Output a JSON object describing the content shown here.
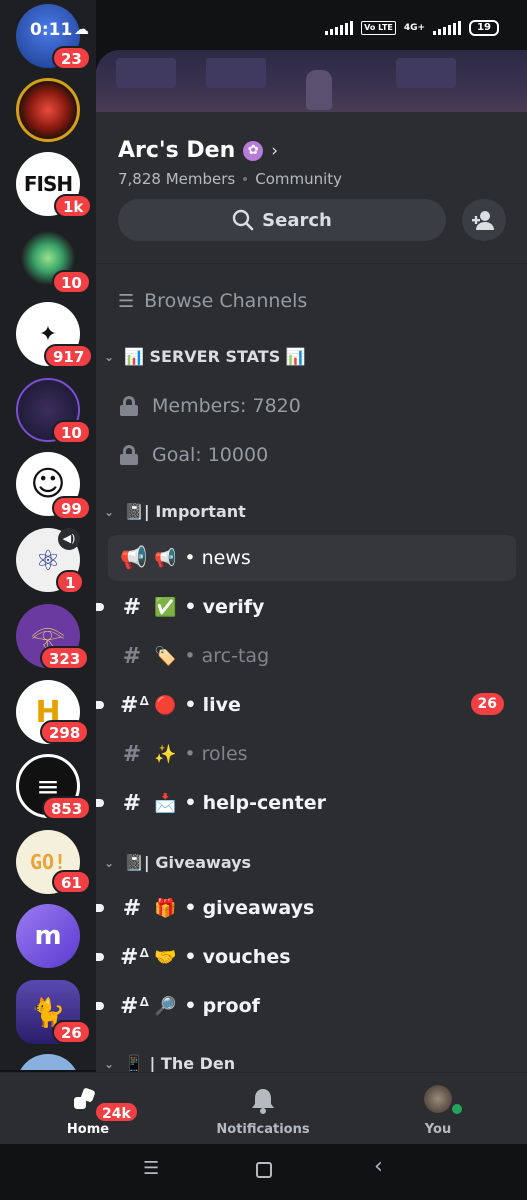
{
  "status": {
    "time": "0:11",
    "network": "4G+",
    "volte": "Vo LTE",
    "battery": "19"
  },
  "servers": [
    {
      "badge": "23",
      "bg": "#2a5bd7"
    },
    {
      "badge": "",
      "bg": "#c0392b"
    },
    {
      "badge": "1k",
      "bg": "#ffffff",
      "logo_text": "FISH"
    },
    {
      "badge": "10",
      "bg": "#2e7d4f"
    },
    {
      "badge": "917",
      "bg": "#ffffff"
    },
    {
      "badge": "10",
      "bg": "#2a2a3a"
    },
    {
      "badge": "99",
      "bg": "#ffffff"
    },
    {
      "badge": "1",
      "bg": "#f0f0f0"
    },
    {
      "badge": "323",
      "bg": "#6a3aa0"
    },
    {
      "badge": "298",
      "bg": "#ffffff"
    },
    {
      "badge": "853",
      "bg": "#111111"
    },
    {
      "badge": "61",
      "bg": "#f5f0dc",
      "logo_text": "GO!"
    },
    {
      "badge": "",
      "bg": "#7b4fd6"
    },
    {
      "badge": "26",
      "bg": "#3b2a7a"
    }
  ],
  "server": {
    "name": "Arc's Den",
    "members": "7,828 Members",
    "type": "Community",
    "search_label": "Search"
  },
  "browse_label": "Browse Channels",
  "categories": {
    "stats": "📊 SERVER STATS 📊",
    "important": "📓| Important",
    "giveaways": "📓| Giveaways",
    "den": "📱 | The Den"
  },
  "stats_channels": [
    {
      "label": "Members: 7820"
    },
    {
      "label": "Goal: 10000"
    }
  ],
  "channels": [
    {
      "emoji": "📢",
      "name": "news"
    },
    {
      "emoji": "✅",
      "name": "verify"
    },
    {
      "emoji": "🏷️",
      "name": "arc-tag"
    },
    {
      "emoji": "🔴",
      "name": "live",
      "count": "26"
    },
    {
      "emoji": "✨",
      "name": "roles"
    },
    {
      "emoji": "📩",
      "name": "help-center"
    },
    {
      "emoji": "🎁",
      "name": "giveaways"
    },
    {
      "emoji": "🤝",
      "name": "vouches"
    },
    {
      "emoji": "🔎",
      "name": "proof"
    }
  ],
  "nav": {
    "home": "Home",
    "home_badge": "24k",
    "notifications": "Notifications",
    "you": "You"
  },
  "colors": {
    "accent": "#5865f2",
    "danger": "#f23f43",
    "online": "#23a55a"
  }
}
